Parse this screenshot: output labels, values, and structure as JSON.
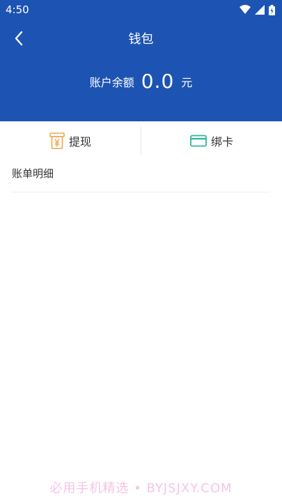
{
  "status_bar": {
    "time": "4:50"
  },
  "header": {
    "title": "钱包"
  },
  "balance": {
    "label": "账户余额",
    "value": "0.0",
    "unit": "元"
  },
  "actions": {
    "withdraw_label": "提现",
    "bind_card_label": "绑卡"
  },
  "bill": {
    "title": "账单明细"
  },
  "watermark": "必用手机精选 • BYJSJXY.COM",
  "colors": {
    "primary": "#1d54b3",
    "withdraw_icon": "#f0a64a",
    "card_icon": "#2bb79b"
  },
  "icons": {
    "back": "chevron-left-icon",
    "withdraw": "withdraw-icon",
    "card": "card-icon"
  }
}
